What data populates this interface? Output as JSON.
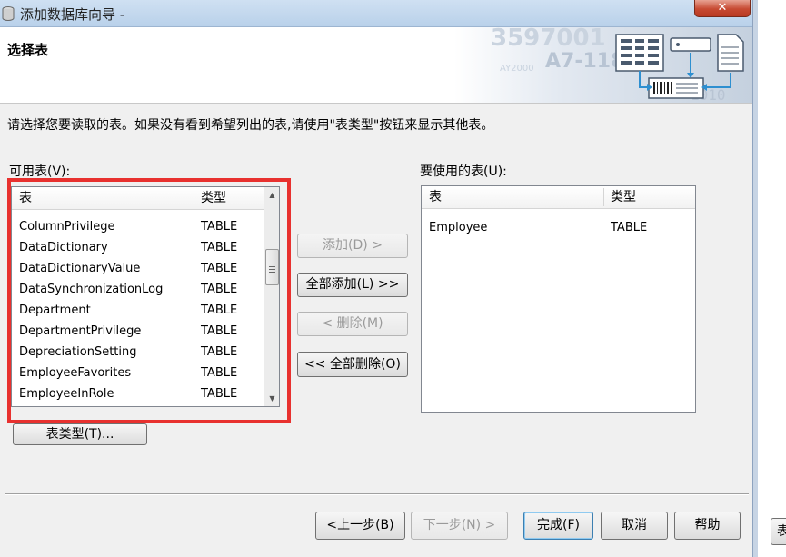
{
  "window": {
    "title": "添加数据库向导 -",
    "close_label": "✕"
  },
  "header": {
    "title": "选择表",
    "banner_codes": [
      "3597001",
      "A7-118",
      "AY2000"
    ]
  },
  "instruction": "请选择您要读取的表。如果没有看到希望列出的表,请使用\"表类型\"按钮来显示其他表。",
  "available": {
    "label": "可用表(V):",
    "columns": [
      "表",
      "类型"
    ],
    "rows": [
      {
        "name": "ColumnPrivilege",
        "type": "TABLE"
      },
      {
        "name": "DataDictionary",
        "type": "TABLE"
      },
      {
        "name": "DataDictionaryValue",
        "type": "TABLE"
      },
      {
        "name": "DataSynchronizationLog",
        "type": "TABLE"
      },
      {
        "name": "Department",
        "type": "TABLE"
      },
      {
        "name": "DepartmentPrivilege",
        "type": "TABLE"
      },
      {
        "name": "DepreciationSetting",
        "type": "TABLE"
      },
      {
        "name": "EmployeeFavorites",
        "type": "TABLE"
      },
      {
        "name": "EmployeeInRole",
        "type": "TABLE"
      }
    ]
  },
  "selected": {
    "label": "要使用的表(U):",
    "columns": [
      "表",
      "类型"
    ],
    "rows": [
      {
        "name": "Employee",
        "type": "TABLE"
      }
    ]
  },
  "actions": {
    "add": "添加(D) >",
    "add_all": "全部添加(L) >>",
    "remove": "< 删除(M)",
    "remove_all": "<< 全部删除(O)",
    "table_types": "表类型(T)..."
  },
  "footer": {
    "back": "<上一步(B)",
    "next": "下一步(N) >",
    "finish": "完成(F)",
    "cancel": "取消",
    "help": "帮助"
  },
  "side_window": {
    "button_char": "表"
  },
  "colors": {
    "highlight": "#e8312f",
    "titlebar": "#b9d1ea",
    "close": "#c74a32"
  }
}
